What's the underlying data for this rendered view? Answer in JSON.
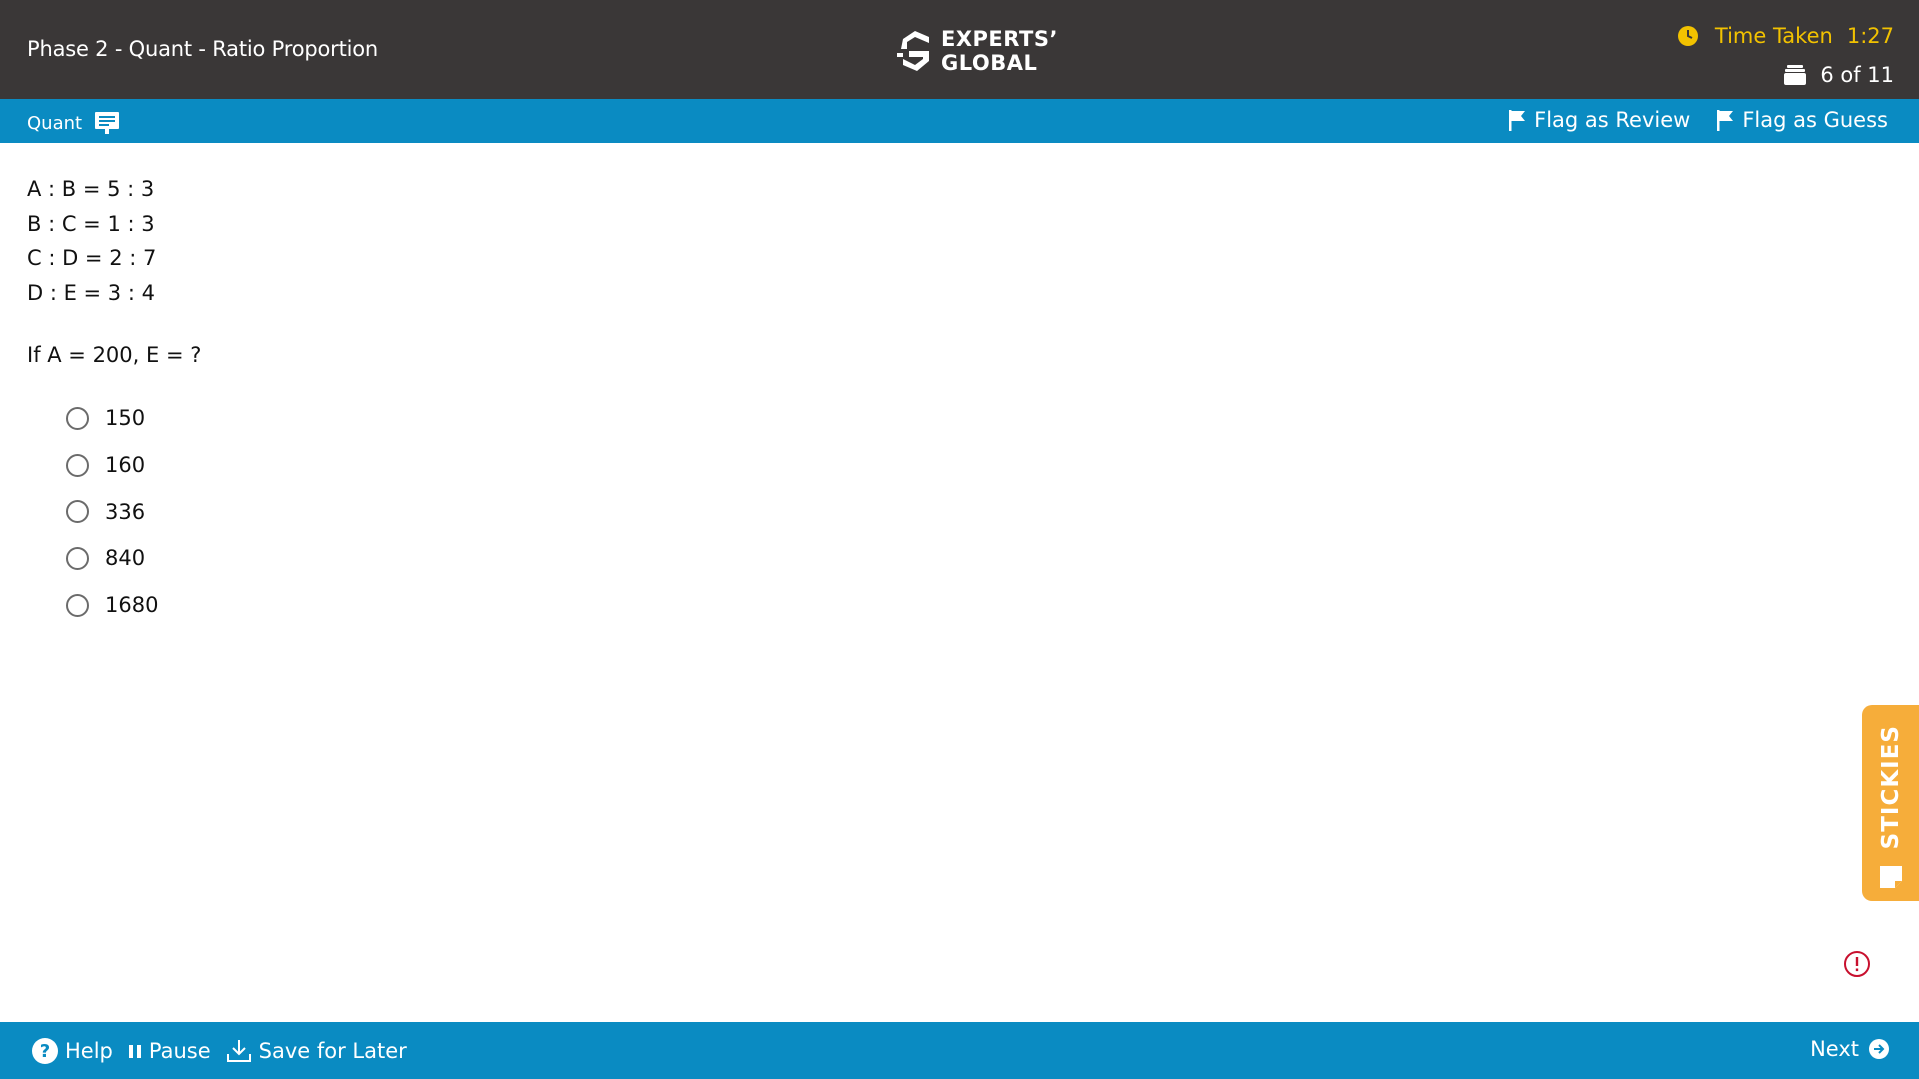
{
  "header": {
    "title": "Phase 2 - Quant - Ratio Proportion",
    "logo_line1": "EXPERTS’",
    "logo_line2": "GLOBAL",
    "timer_label": "Time Taken",
    "timer_value": "1:27",
    "question_counter": "6 of 11"
  },
  "subbar": {
    "section_label": "Quant",
    "flag_review_label": "Flag as Review",
    "flag_guess_label": "Flag as Guess"
  },
  "question": {
    "statements": [
      "A : B = 5 : 3",
      "B : C = 1 : 3",
      "C : D = 2 : 7",
      "D : E = 3 : 4"
    ],
    "prompt": "If A = 200, E = ?",
    "options": [
      "150",
      "160",
      "336",
      "840",
      "1680"
    ],
    "selected": null
  },
  "stickies": {
    "label": "STICKIES"
  },
  "footer": {
    "help_label": "Help",
    "pause_label": "Pause",
    "save_label": "Save for Later",
    "next_label": "Next"
  },
  "colors": {
    "header_bg": "#3a3737",
    "bar_blue": "#0a8bc2",
    "timer_yellow": "#f2c200",
    "stickies_orange": "#f6ad3a",
    "alert_red": "#c8102e"
  },
  "icons": [
    "clock-icon",
    "question-stack-icon",
    "calculator-icon",
    "flag-icon",
    "help-icon",
    "pause-icon",
    "download-icon",
    "arrow-right-circle-icon",
    "sticky-note-icon",
    "alert-icon"
  ]
}
